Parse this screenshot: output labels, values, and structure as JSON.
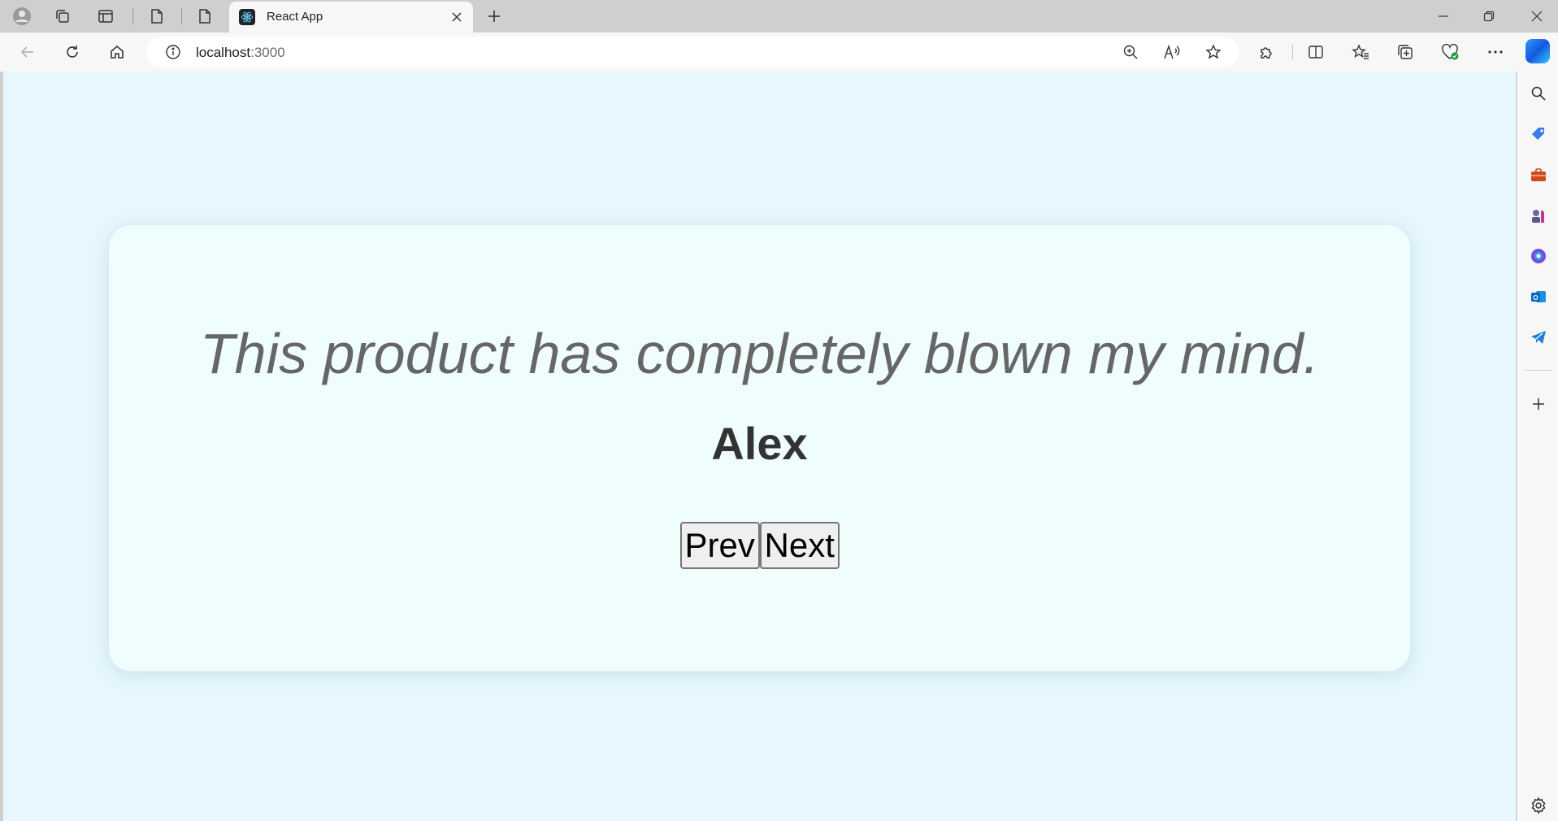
{
  "browser": {
    "tab_title": "React App",
    "url_host": "localhost",
    "url_port": ":3000"
  },
  "page": {
    "quote": "This product has completely blown my mind.",
    "author": "Alex",
    "prev_label": "Prev",
    "next_label": "Next"
  },
  "colors": {
    "page_bg": "#e6f7fd",
    "card_bg": "#effdfd",
    "quote_text": "#666666",
    "author_text": "#333333"
  },
  "icons": {
    "tabstrip": [
      "profile-icon",
      "workspaces-icon",
      "tab-actions-icon",
      "page-icon",
      "page-icon",
      "react-favicon",
      "close-icon",
      "new-tab-icon"
    ],
    "window": [
      "minimize-icon",
      "restore-icon",
      "close-window-icon"
    ],
    "toolbar": [
      "back-icon",
      "refresh-icon",
      "home-icon",
      "info-icon",
      "zoom-icon",
      "read-aloud-icon",
      "favorite-star-icon",
      "extensions-icon",
      "split-screen-icon",
      "favorites-icon",
      "collections-icon",
      "browser-essentials-icon",
      "more-icon",
      "copilot-icon"
    ],
    "sidebar": [
      "search-icon",
      "shopping-icon",
      "tools-icon",
      "games-icon",
      "microsoft365-icon",
      "outlook-icon",
      "telegram-icon",
      "add-icon",
      "settings-icon"
    ]
  }
}
